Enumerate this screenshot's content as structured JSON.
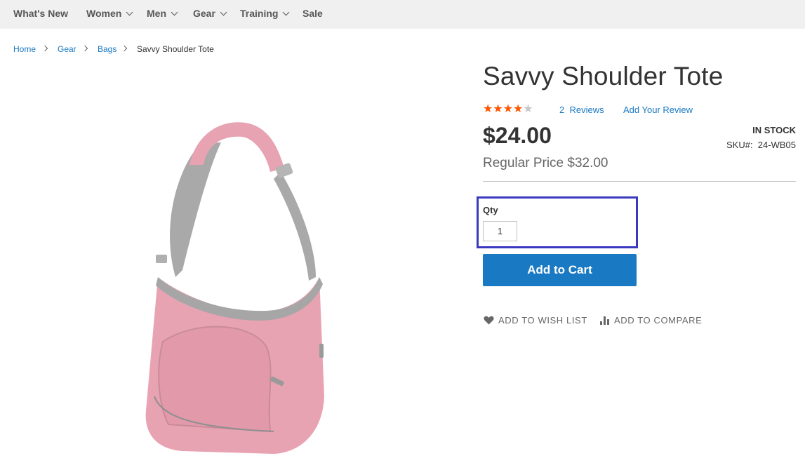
{
  "nav": {
    "items": [
      {
        "label": "What's New",
        "has_dropdown": false
      },
      {
        "label": "Women",
        "has_dropdown": true
      },
      {
        "label": "Men",
        "has_dropdown": true
      },
      {
        "label": "Gear",
        "has_dropdown": true
      },
      {
        "label": "Training",
        "has_dropdown": true
      },
      {
        "label": "Sale",
        "has_dropdown": false
      }
    ]
  },
  "breadcrumbs": {
    "items": [
      "Home",
      "Gear",
      "Bags"
    ],
    "current": "Savvy Shoulder Tote"
  },
  "product": {
    "name": "Savvy Shoulder Tote",
    "rating": {
      "stars_filled": 4,
      "stars_total": 5,
      "percent": 80
    },
    "reviews_count": "2",
    "reviews_word": "Reviews",
    "add_review": "Add Your Review",
    "price": "$24.00",
    "regular_price": "Regular Price $32.00",
    "stock": "IN STOCK",
    "sku_label": "SKU#:",
    "sku_value": "24-WB05",
    "qty_label": "Qty",
    "qty_value": "1",
    "add_to_cart": "Add to Cart",
    "wishlist": "ADD TO WISH LIST",
    "compare": "ADD TO COMPARE",
    "image_color": "#e8a3b2",
    "image_trim_color": "#a6a6a6"
  },
  "colors": {
    "accent": "#1979c3",
    "star": "#ff5501",
    "highlight_box": "#3a3abf"
  }
}
